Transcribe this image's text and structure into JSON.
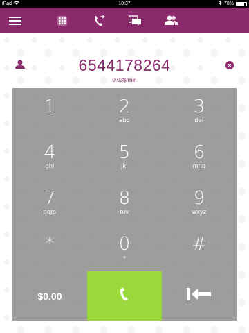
{
  "status": {
    "device": "iPad",
    "time": "10:37",
    "battery": "78%",
    "battery_level": 0.78
  },
  "nav": {
    "icons": [
      "menu-icon",
      "dialpad-icon",
      "call-history-icon",
      "messages-icon",
      "contacts-icon"
    ]
  },
  "dialer": {
    "number": "6544178264",
    "rate": "0.03$/min",
    "balance": "$0.00"
  },
  "keys": [
    {
      "digit": "1",
      "letters": ""
    },
    {
      "digit": "2",
      "letters": "abc"
    },
    {
      "digit": "3",
      "letters": "def"
    },
    {
      "digit": "4",
      "letters": "ghi"
    },
    {
      "digit": "5",
      "letters": "jkl"
    },
    {
      "digit": "6",
      "letters": "mno"
    },
    {
      "digit": "7",
      "letters": "pqrs"
    },
    {
      "digit": "8",
      "letters": "tuv"
    },
    {
      "digit": "9",
      "letters": "wxyz"
    },
    {
      "digit": "*",
      "letters": ""
    },
    {
      "digit": "0",
      "letters": "+"
    },
    {
      "digit": "#",
      "letters": ""
    }
  ],
  "colors": {
    "brand": "#8a2a6c",
    "call": "#9bd83b",
    "keypad": "#828282"
  }
}
